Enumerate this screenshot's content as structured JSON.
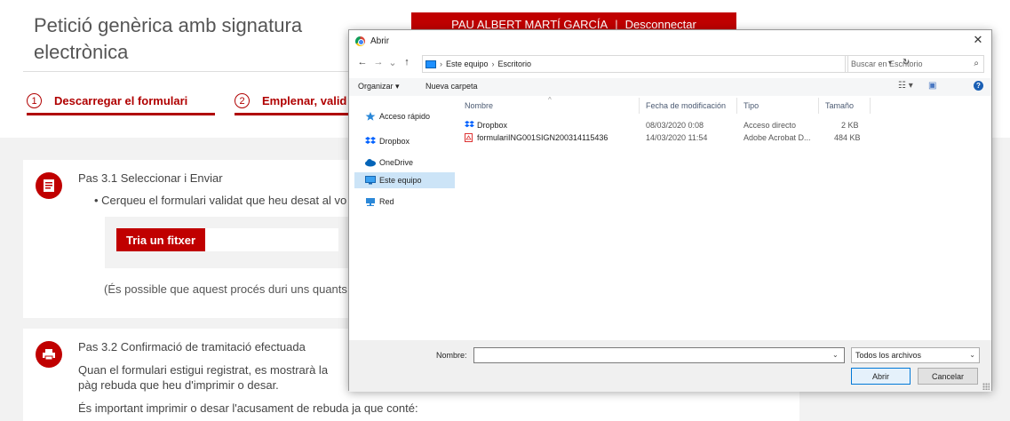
{
  "page": {
    "title": "Petició genèrica amb signatura electrònica",
    "user_name": "PAU ALBERT MARTÍ GARCÍA",
    "user_separator": "|",
    "logout_label": "Desconnectar",
    "steps": [
      {
        "num": "1",
        "label": "Descarregar el formulari"
      },
      {
        "num": "2",
        "label": "Emplenar, valid"
      }
    ],
    "card1": {
      "heading": "Pas 3.1 Seleccionar i Enviar",
      "bullet": "•  Cerqueu el formulari validat que heu desat al vo",
      "choose_button": "Tria un fitxer",
      "note": "(És possible que aquest procés duri uns quants s"
    },
    "card2": {
      "heading": "Pas 3.2 Confirmació de tramitació efectuada",
      "paragraph_a": "Quan el formulari estigui registrat, es mostrarà la pàg rebuda que heu d'imprimir o desar.",
      "paragraph_b": "És important imprimir o desar l'acusament de rebuda ja que conté:"
    },
    "colors": {
      "brand_red": "#c00000",
      "page_gray": "#f2f2f2"
    }
  },
  "dialog": {
    "title": "Abrir",
    "close_glyph": "✕",
    "nav": {
      "back": "←",
      "forward": "→",
      "recent": "⌄",
      "up": "↑"
    },
    "address": {
      "crumbs": [
        "Este equipo",
        "Escritorio"
      ],
      "separator": "›"
    },
    "search_placeholder": "Buscar en Escritorio",
    "toolbar": {
      "organize": "Organizar ▾",
      "new_folder": "Nueva carpeta"
    },
    "sidebar": [
      {
        "label": "Acceso rápido",
        "icon": "star-icon",
        "selected": false
      },
      {
        "label": "Dropbox",
        "icon": "dropbox-icon",
        "selected": false
      },
      {
        "label": "OneDrive",
        "icon": "cloud-icon",
        "selected": false
      },
      {
        "label": "Este equipo",
        "icon": "computer-icon",
        "selected": true
      },
      {
        "label": "Red",
        "icon": "network-icon",
        "selected": false
      }
    ],
    "columns": [
      "Nombre",
      "Fecha de modificación",
      "Tipo",
      "Tamaño"
    ],
    "files": [
      {
        "name": "Dropbox",
        "date": "08/03/2020 0:08",
        "type": "Acceso directo",
        "size": "2 KB",
        "icon": "dropbox-icon"
      },
      {
        "name": "formulariING001SIGN200314115436",
        "date": "14/03/2020 11:54",
        "type": "Adobe Acrobat D...",
        "size": "484 KB",
        "icon": "pdf-icon"
      }
    ],
    "filename_label": "Nombre:",
    "filename_value": "",
    "filetype": "Todos los archivos",
    "open_button": "Abrir",
    "cancel_button": "Cancelar"
  }
}
